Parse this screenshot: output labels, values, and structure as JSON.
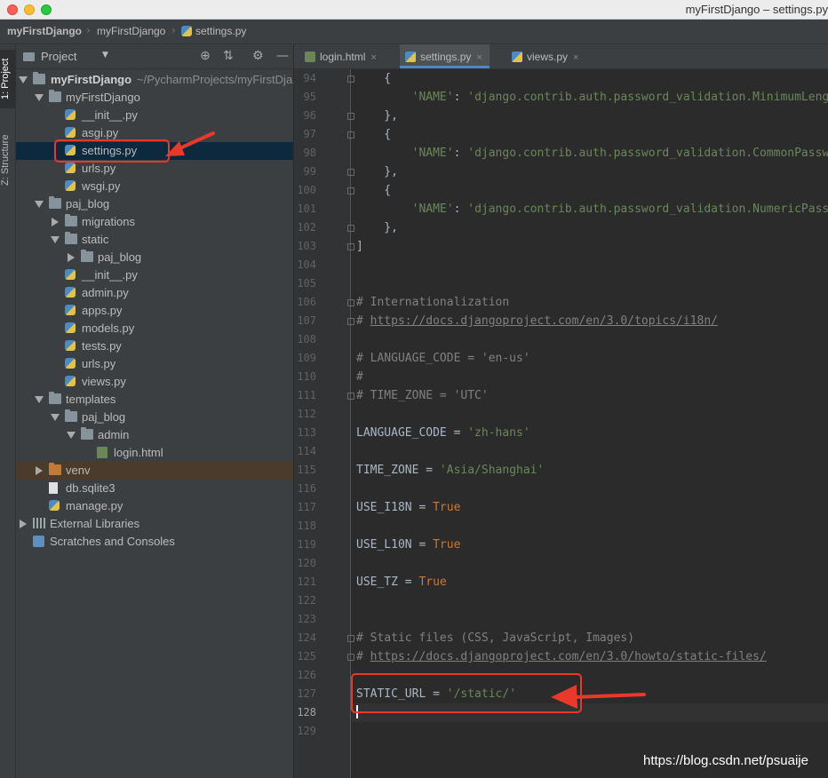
{
  "window": {
    "title": "myFirstDjango – settings.py"
  },
  "breadcrumb": {
    "items": [
      "myFirstDjango",
      "myFirstDjango",
      "settings.py"
    ]
  },
  "tool_strip": {
    "project_tab": "1: Project",
    "structure_tab": "Z: Structure"
  },
  "project_panel": {
    "title": "Project",
    "root_name": "myFirstDjango",
    "root_path": "~/PycharmProjects/myFirstDjango",
    "items": [
      {
        "label": "myFirstDjango",
        "type": "folder",
        "depth": 1,
        "state": "open"
      },
      {
        "label": "__init__.py",
        "type": "py",
        "depth": 2
      },
      {
        "label": "asgi.py",
        "type": "py",
        "depth": 2
      },
      {
        "label": "settings.py",
        "type": "py",
        "depth": 2,
        "selected": true
      },
      {
        "label": "urls.py",
        "type": "py",
        "depth": 2
      },
      {
        "label": "wsgi.py",
        "type": "py",
        "depth": 2
      },
      {
        "label": "paj_blog",
        "type": "folder",
        "depth": 1,
        "state": "open"
      },
      {
        "label": "migrations",
        "type": "folder",
        "depth": 2,
        "state": "closed"
      },
      {
        "label": "static",
        "type": "folder",
        "depth": 2,
        "state": "open"
      },
      {
        "label": "paj_blog",
        "type": "folder",
        "depth": 3,
        "state": "closed"
      },
      {
        "label": "__init__.py",
        "type": "py",
        "depth": 2
      },
      {
        "label": "admin.py",
        "type": "py",
        "depth": 2
      },
      {
        "label": "apps.py",
        "type": "py",
        "depth": 2
      },
      {
        "label": "models.py",
        "type": "py",
        "depth": 2
      },
      {
        "label": "tests.py",
        "type": "py",
        "depth": 2
      },
      {
        "label": "urls.py",
        "type": "py",
        "depth": 2
      },
      {
        "label": "views.py",
        "type": "py",
        "depth": 2
      },
      {
        "label": "templates",
        "type": "folder",
        "depth": 1,
        "state": "open"
      },
      {
        "label": "paj_blog",
        "type": "folder",
        "depth": 2,
        "state": "open"
      },
      {
        "label": "admin",
        "type": "folder",
        "depth": 3,
        "state": "open"
      },
      {
        "label": "login.html",
        "type": "html",
        "depth": 4
      },
      {
        "label": "venv",
        "type": "folder-orange",
        "depth": 1,
        "state": "closed"
      },
      {
        "label": "db.sqlite3",
        "type": "db",
        "depth": 1
      },
      {
        "label": "manage.py",
        "type": "py",
        "depth": 1
      },
      {
        "label": "External Libraries",
        "type": "libs",
        "depth": 0,
        "state": "closed"
      },
      {
        "label": "Scratches and Consoles",
        "type": "scratch",
        "depth": 0
      }
    ]
  },
  "editor": {
    "tabs": [
      {
        "label": "login.html",
        "type": "html",
        "active": false
      },
      {
        "label": "settings.py",
        "type": "py",
        "active": true
      },
      {
        "label": "views.py",
        "type": "py",
        "active": false
      }
    ],
    "lines": [
      {
        "n": "94",
        "parts": [
          [
            "p",
            "    {"
          ]
        ]
      },
      {
        "n": "95",
        "parts": [
          [
            "p",
            "        "
          ],
          [
            "s",
            "'NAME'"
          ],
          [
            "p",
            ": "
          ],
          [
            "s",
            "'django.contrib.auth.password_validation.MinimumLengthValidator'"
          ],
          [
            "p",
            ","
          ]
        ]
      },
      {
        "n": "96",
        "parts": [
          [
            "p",
            "    },"
          ]
        ]
      },
      {
        "n": "97",
        "parts": [
          [
            "p",
            "    {"
          ]
        ]
      },
      {
        "n": "98",
        "parts": [
          [
            "p",
            "        "
          ],
          [
            "s",
            "'NAME'"
          ],
          [
            "p",
            ": "
          ],
          [
            "s",
            "'django.contrib.auth.password_validation.CommonPasswordValidator'"
          ],
          [
            "p",
            ","
          ]
        ]
      },
      {
        "n": "99",
        "parts": [
          [
            "p",
            "    },"
          ]
        ]
      },
      {
        "n": "100",
        "parts": [
          [
            "p",
            "    {"
          ]
        ]
      },
      {
        "n": "101",
        "parts": [
          [
            "p",
            "        "
          ],
          [
            "s",
            "'NAME'"
          ],
          [
            "p",
            ": "
          ],
          [
            "s",
            "'django.contrib.auth.password_validation.NumericPasswordValidator'"
          ],
          [
            "p",
            ","
          ]
        ]
      },
      {
        "n": "102",
        "parts": [
          [
            "p",
            "    },"
          ]
        ]
      },
      {
        "n": "103",
        "parts": [
          [
            "p",
            "]"
          ]
        ]
      },
      {
        "n": "104",
        "parts": []
      },
      {
        "n": "105",
        "parts": []
      },
      {
        "n": "106",
        "parts": [
          [
            "c",
            "# Internationalization"
          ]
        ]
      },
      {
        "n": "107",
        "parts": [
          [
            "c",
            "# "
          ],
          [
            "l",
            "https://docs.djangoproject.com/en/3.0/topics/i18n/"
          ]
        ]
      },
      {
        "n": "108",
        "parts": []
      },
      {
        "n": "109",
        "parts": [
          [
            "c",
            "# LANGUAGE_CODE = 'en-us'"
          ]
        ]
      },
      {
        "n": "110",
        "parts": [
          [
            "c",
            "#"
          ]
        ]
      },
      {
        "n": "111",
        "parts": [
          [
            "c",
            "# TIME_ZONE = 'UTC'"
          ]
        ]
      },
      {
        "n": "112",
        "parts": []
      },
      {
        "n": "113",
        "parts": [
          [
            "p",
            "LANGUAGE_CODE = "
          ],
          [
            "s",
            "'zh-hans'"
          ]
        ]
      },
      {
        "n": "114",
        "parts": []
      },
      {
        "n": "115",
        "parts": [
          [
            "p",
            "TIME_ZONE = "
          ],
          [
            "s",
            "'Asia/Shanghai'"
          ]
        ]
      },
      {
        "n": "116",
        "parts": []
      },
      {
        "n": "117",
        "parts": [
          [
            "p",
            "USE_I18N = "
          ],
          [
            "k",
            "True"
          ]
        ]
      },
      {
        "n": "118",
        "parts": []
      },
      {
        "n": "119",
        "parts": [
          [
            "p",
            "USE_L10N = "
          ],
          [
            "k",
            "True"
          ]
        ]
      },
      {
        "n": "120",
        "parts": []
      },
      {
        "n": "121",
        "parts": [
          [
            "p",
            "USE_TZ = "
          ],
          [
            "k",
            "True"
          ]
        ]
      },
      {
        "n": "122",
        "parts": []
      },
      {
        "n": "123",
        "parts": []
      },
      {
        "n": "124",
        "parts": [
          [
            "c",
            "# Static files (CSS, JavaScript, Images)"
          ]
        ]
      },
      {
        "n": "125",
        "parts": [
          [
            "c",
            "# "
          ],
          [
            "l",
            "https://docs.djangoproject.com/en/3.0/howto/static-files/"
          ]
        ]
      },
      {
        "n": "126",
        "parts": []
      },
      {
        "n": "127",
        "parts": [
          [
            "p",
            "STATIC_URL = "
          ],
          [
            "s",
            "'/static/'"
          ]
        ]
      },
      {
        "n": "128",
        "parts": [],
        "current": true
      },
      {
        "n": "129",
        "parts": []
      }
    ]
  },
  "colors": {
    "annotation": "#e8392b",
    "selection": "#0d293e",
    "string": "#6a8759",
    "keyword": "#cc7832",
    "comment": "#808080"
  },
  "watermark": "https://blog.csdn.net/psuaije"
}
